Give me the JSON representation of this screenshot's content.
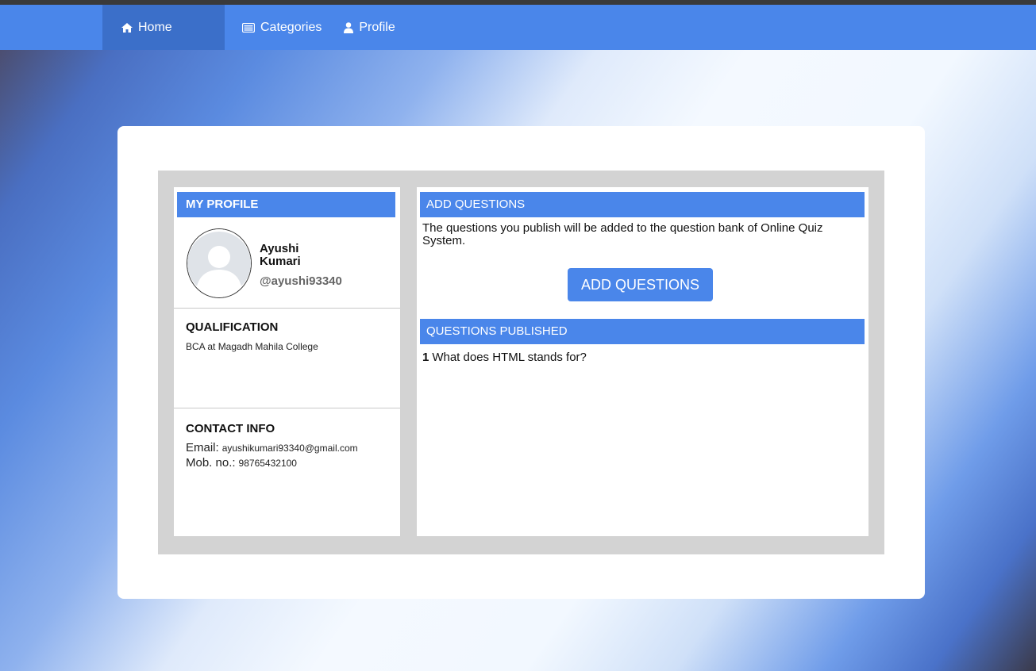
{
  "nav": {
    "home": "Home",
    "categories": "Categories",
    "profile": "Profile"
  },
  "profile": {
    "header": "MY PROFILE",
    "first_name": "Ayushi",
    "last_name": "Kumari",
    "username": "@ayushi93340",
    "qualification_title": "QUALIFICATION",
    "qualification": "BCA at Magadh Mahila College",
    "contact_title": "CONTACT INFO",
    "email_label": "Email:",
    "email": "ayushikumari93340@gmail.com",
    "mobile_label": "Mob. no.:",
    "mobile": "98765432100"
  },
  "add_questions": {
    "header": "ADD QUESTIONS",
    "description": "The questions you publish will be added to the question bank of Online Quiz System.",
    "button": "ADD QUESTIONS"
  },
  "published": {
    "header": "QUESTIONS PUBLISHED",
    "items": [
      {
        "number": "1",
        "text": "What does HTML stands for?"
      }
    ]
  },
  "colors": {
    "accent": "#4a86ea",
    "nav_active": "#3b6fc9",
    "frame": "#d3d3d3"
  }
}
